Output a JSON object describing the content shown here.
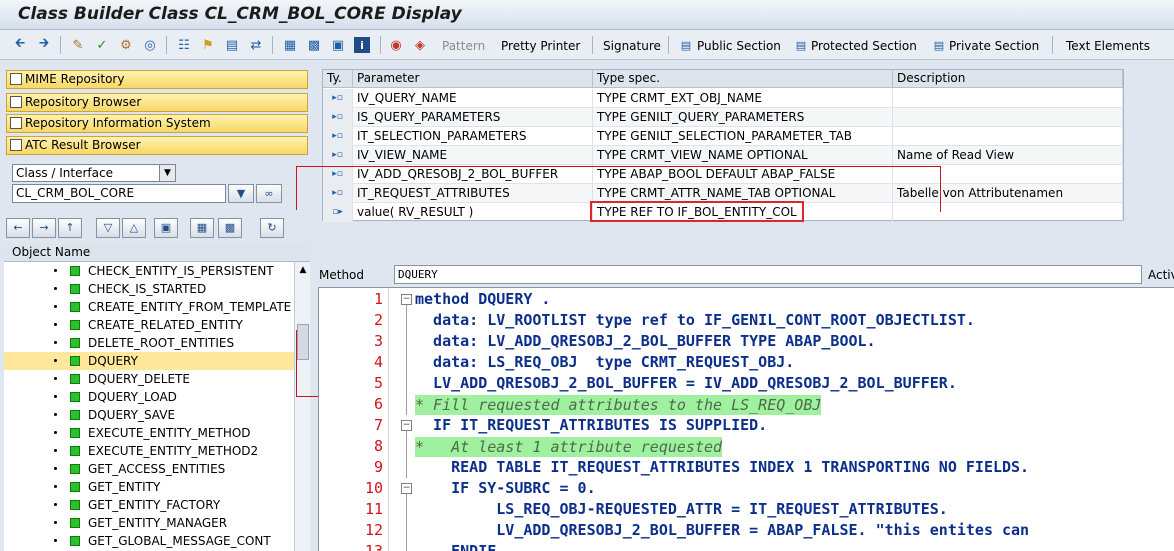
{
  "title": "Class Builder Class CL_CRM_BOL_CORE Display",
  "toolbar": {
    "pattern": "Pattern",
    "pretty_printer": "Pretty Printer",
    "signature": "Signature",
    "public_section": "Public Section",
    "protected_section": "Protected Section",
    "private_section": "Private Section",
    "text_elements": "Text Elements"
  },
  "left": {
    "buttons": [
      "MIME Repository",
      "Repository Browser",
      "Repository Information System",
      "ATC Result Browser"
    ],
    "object_type": "Class / Interface",
    "object_name": "CL_CRM_BOL_CORE",
    "tree_header": "Object Name",
    "tree_items": [
      "CHECK_ENTITY_IS_PERSISTENT",
      "CHECK_IS_STARTED",
      "CREATE_ENTITY_FROM_TEMPLATE",
      "CREATE_RELATED_ENTITY",
      "DELETE_ROOT_ENTITIES",
      "DQUERY",
      "DQUERY_DELETE",
      "DQUERY_LOAD",
      "DQUERY_SAVE",
      "EXECUTE_ENTITY_METHOD",
      "EXECUTE_ENTITY_METHOD2",
      "GET_ACCESS_ENTITIES",
      "GET_ENTITY",
      "GET_ENTITY_FACTORY",
      "GET_ENTITY_MANAGER",
      "GET_GLOBAL_MESSAGE_CONT"
    ],
    "selected_item": "DQUERY"
  },
  "params": {
    "headers": [
      "Ty.",
      "Parameter",
      "Type spec.",
      "Description"
    ],
    "rows": [
      {
        "param": "IV_QUERY_NAME",
        "type": "TYPE CRMT_EXT_OBJ_NAME",
        "desc": ""
      },
      {
        "param": "IS_QUERY_PARAMETERS",
        "type": "TYPE GENILT_QUERY_PARAMETERS",
        "desc": ""
      },
      {
        "param": "IT_SELECTION_PARAMETERS",
        "type": "TYPE GENILT_SELECTION_PARAMETER_TAB",
        "desc": ""
      },
      {
        "param": "IV_VIEW_NAME",
        "type": "TYPE CRMT_VIEW_NAME OPTIONAL",
        "desc": "Name of Read View"
      },
      {
        "param": "IV_ADD_QRESOBJ_2_BOL_BUFFER",
        "type": "TYPE ABAP_BOOL  DEFAULT ABAP_FALSE",
        "desc": ""
      },
      {
        "param": "IT_REQUEST_ATTRIBUTES",
        "type": "TYPE CRMT_ATTR_NAME_TAB OPTIONAL",
        "desc": "Tabelle von Attributenamen"
      },
      {
        "param": "value( RV_RESULT )",
        "type": "TYPE REF TO IF_BOL_ENTITY_COL",
        "desc": ""
      }
    ]
  },
  "method": {
    "label": "Method",
    "name": "DQUERY",
    "status": "Active"
  },
  "code": {
    "line_numbers": [
      "1",
      "2",
      "3",
      "4",
      "5",
      "6",
      "7",
      "8",
      "9",
      "10",
      "11",
      "12",
      "13"
    ],
    "lines": [
      "method DQUERY .",
      "  data: LV_ROOTLIST type ref to IF_GENIL_CONT_ROOT_OBJECTLIST.",
      "  data: LV_ADD_QRESOBJ_2_BOL_BUFFER TYPE ABAP_BOOL.",
      "  data: LS_REQ_OBJ  type CRMT_REQUEST_OBJ.",
      "  LV_ADD_QRESOBJ_2_BOL_BUFFER = IV_ADD_QRESOBJ_2_BOL_BUFFER.",
      "* Fill requested attributes to the LS_REQ_OBJ",
      "  IF IT_REQUEST_ATTRIBUTES IS SUPPLIED.",
      "*   At least 1 attribute requested",
      "    READ TABLE IT_REQUEST_ATTRIBUTES INDEX 1 TRANSPORTING NO FIELDS.",
      "    IF SY-SUBRC = 0.",
      "         LS_REQ_OBJ-REQUESTED_ATTR = IT_REQUEST_ATTRIBUTES.",
      "         LV_ADD_QRESOBJ_2_BOL_BUFFER = ABAP_FALSE. \"this entites can",
      "    ENDIF"
    ]
  }
}
